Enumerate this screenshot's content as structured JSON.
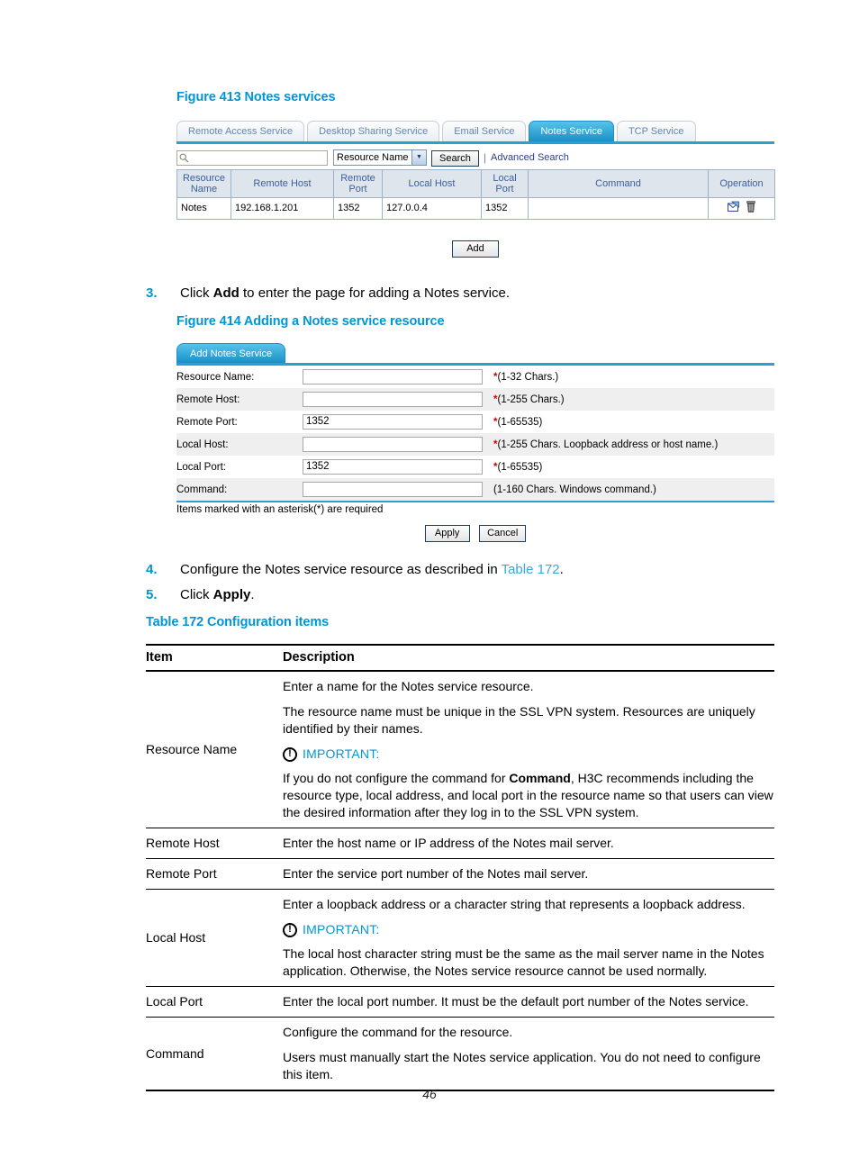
{
  "figure413": {
    "caption": "Figure 413 Notes services",
    "tabs": [
      {
        "label": "Remote Access Service",
        "active": false
      },
      {
        "label": "Desktop Sharing Service",
        "active": false
      },
      {
        "label": "Email Service",
        "active": false
      },
      {
        "label": "Notes Service",
        "active": true
      },
      {
        "label": "TCP Service",
        "active": false
      }
    ],
    "search": {
      "input_value": "",
      "select_value": "Resource Name",
      "search_button": "Search",
      "advanced_link": "Advanced Search",
      "magnifier_icon": "search-icon",
      "separator": "|"
    },
    "table": {
      "headers": [
        "Resource Name",
        "Remote Host",
        "Remote Port",
        "Local Host",
        "Local Port",
        "Command",
        "Operation"
      ],
      "rows": [
        {
          "resource_name": "Notes",
          "remote_host": "192.168.1.201",
          "remote_port": "1352",
          "local_host": "127.0.0.4",
          "local_port": "1352",
          "command": "",
          "operation_icons": [
            "edit-icon",
            "delete-icon"
          ]
        }
      ]
    },
    "add_button": "Add"
  },
  "step3": {
    "number": "3.",
    "text_before": "Click ",
    "bold": "Add",
    "text_after": " to enter the page for adding a Notes service."
  },
  "figure414": {
    "caption": "Figure 414 Adding a Notes service resource",
    "tab": "Add Notes Service",
    "fields": [
      {
        "label": "Resource Name:",
        "value": "",
        "required": "*",
        "hint": "(1-32 Chars.)"
      },
      {
        "label": "Remote Host:",
        "value": "",
        "required": "*",
        "hint": "(1-255 Chars.)"
      },
      {
        "label": "Remote Port:",
        "value": "1352",
        "required": "*",
        "hint": "(1-65535)"
      },
      {
        "label": "Local Host:",
        "value": "",
        "required": "*",
        "hint": "(1-255 Chars. Loopback address or host name.)"
      },
      {
        "label": "Local Port:",
        "value": "1352",
        "required": "*",
        "hint": "(1-65535)"
      },
      {
        "label": "Command:",
        "value": "",
        "required": "",
        "hint": "(1-160 Chars. Windows command.)"
      }
    ],
    "footnote": "Items marked with an asterisk(*) are required",
    "apply_button": "Apply",
    "cancel_button": "Cancel"
  },
  "step4": {
    "number": "4.",
    "text_before": "Configure the Notes service resource as described in ",
    "link": "Table 172",
    "text_after": "."
  },
  "step5": {
    "number": "5.",
    "text_before": "Click ",
    "bold": "Apply",
    "text_after": "."
  },
  "table172": {
    "caption": "Table 172 Configuration items",
    "headers": [
      "Item",
      "Description"
    ],
    "important_label": "IMPORTANT:",
    "important_icon": "exclamation-circle-icon",
    "rows": [
      {
        "item": "Resource Name",
        "paras": [
          "Enter a name for the Notes service resource.",
          "The resource name must be unique in the SSL VPN system. Resources are uniquely identified by their names."
        ],
        "has_important": true,
        "important_paras_pre": "If you do not configure the command for ",
        "important_bold": "Command",
        "important_paras_post": ", H3C recommends including the resource type, local address, and local port in the resource name so that users can view the desired information after they log in to the SSL VPN system."
      },
      {
        "item": "Remote Host",
        "paras": [
          "Enter the host name or IP address of the Notes mail server."
        ],
        "has_important": false
      },
      {
        "item": "Remote Port",
        "paras": [
          "Enter the service port number of the Notes mail server."
        ],
        "has_important": false
      },
      {
        "item": "Local Host",
        "paras": [
          "Enter a loopback address or a character string that represents a loopback address."
        ],
        "has_important": true,
        "important_text": "The local host character string must be the same as the mail server name in the Notes application. Otherwise, the Notes service resource cannot be used normally."
      },
      {
        "item": "Local Port",
        "paras": [
          "Enter the local port number. It must be the default port number of the Notes service."
        ],
        "has_important": false
      },
      {
        "item": "Command",
        "paras": [
          "Configure the command for the resource.",
          "Users must manually start the Notes service application. You do not need to configure this item."
        ],
        "has_important": false
      }
    ]
  },
  "page_number": "46",
  "colors": {
    "heading_blue": "#0096d6",
    "link_blue": "#3aa7dd",
    "tab_active": "#1b8fc6",
    "required_red": "#d40000",
    "grid_header_bg": "#dfe5ec"
  }
}
